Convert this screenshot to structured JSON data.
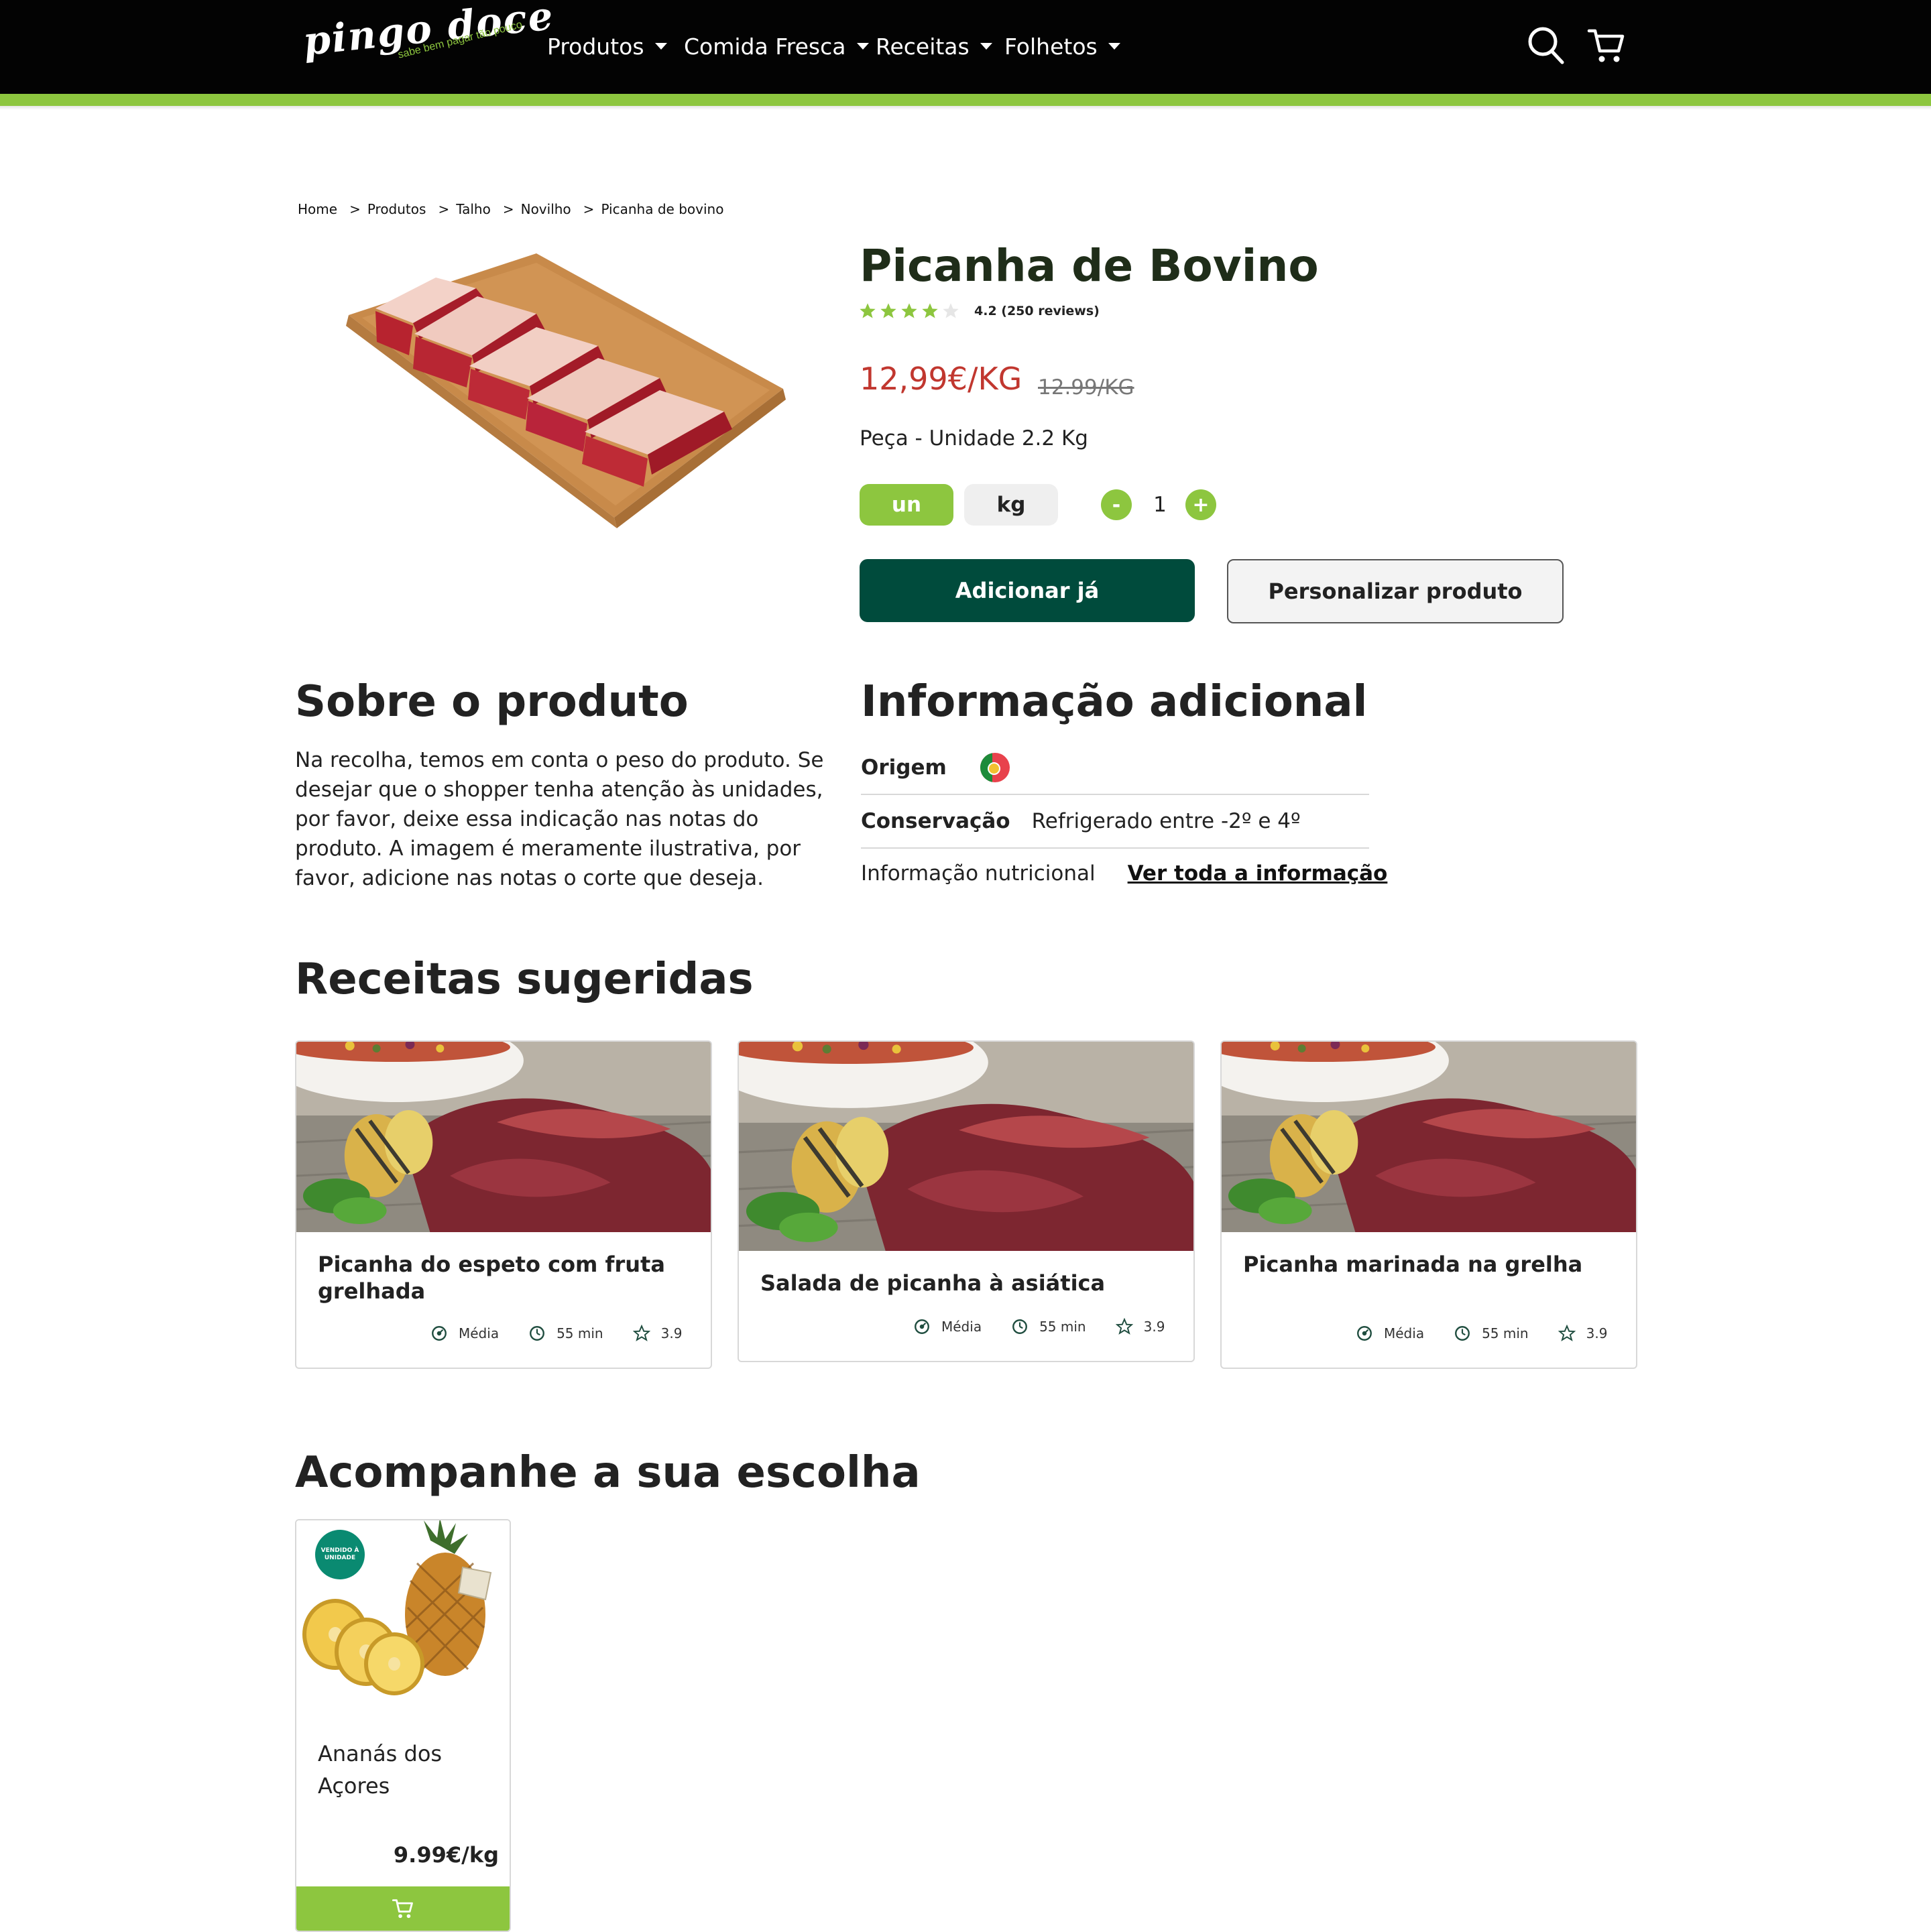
{
  "nav": {
    "logo_text": "pingo doce",
    "logo_tagline": "sabe bem pagar tão pouco",
    "menu": [
      "Produtos",
      "Comida Fresca",
      "Receitas",
      "Folhetos"
    ],
    "search_icon": "search-icon",
    "cart_icon": "cart-icon"
  },
  "breadcrumb": [
    "Home",
    "Produtos",
    "Talho",
    "Novilho",
    "Picanha de bovino"
  ],
  "breadcrumb_separator": ">",
  "product": {
    "title": "Picanha de Bovino",
    "rating_value": 4.2,
    "rating_max": 5,
    "rating_text": "4.2 (250 reviews)",
    "price": "12,99€/KG",
    "old_price": "12.99/KG",
    "unit_description": "Peça - Unidade 2.2 Kg",
    "unit_options": [
      "un",
      "kg"
    ],
    "selected_unit": "un",
    "quantity": "1",
    "minus_label": "-",
    "plus_label": "+",
    "add_button": "Adicionar já",
    "customize_button": "Personalizar produto"
  },
  "about": {
    "heading": "Sobre o produto",
    "text": "Na recolha, temos em conta o peso do produto. Se desejar que o shopper tenha atenção às unidades, por favor, deixe essa indicação nas notas do produto. A imagem é meramente ilustrativa, por favor, adicione nas notas o corte que deseja."
  },
  "additional_info": {
    "heading": "Informação adicional",
    "origin_label": "Origem",
    "origin_flag": "portugal-flag-icon",
    "conservation_label": "Conservação",
    "conservation_value": "Refrigerado entre -2º e 4º",
    "nutrition_label": "Informação nutricional",
    "nutrition_link": "Ver toda a informação"
  },
  "recipes": {
    "heading": "Receitas sugeridas",
    "items": [
      {
        "title": "Picanha do espeto com fruta grelhada",
        "difficulty": "Média",
        "time": "55 min",
        "rating": "3.9"
      },
      {
        "title": "Salada de picanha à asiática",
        "difficulty": "Média",
        "time": "55 min",
        "rating": "3.9"
      },
      {
        "title": "Picanha marinada na grelha",
        "difficulty": "Média",
        "time": "55 min",
        "rating": "3.9"
      }
    ]
  },
  "accompany": {
    "heading": "Acompanhe a sua escolha",
    "items": [
      {
        "badge": "VENDIDO À UNIDADE",
        "name": "Ananás dos Açores",
        "price": "9.99€/kg",
        "cart_icon": "cart-icon"
      }
    ]
  },
  "colors": {
    "brand_green": "#8dc63f",
    "dark_green": "#004b3c",
    "price_red": "#c1372f",
    "nav_black": "#030303"
  }
}
